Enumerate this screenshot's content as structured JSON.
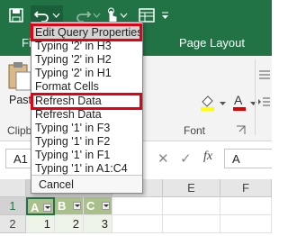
{
  "colors": {
    "excel_green": "#217346",
    "table_header": "#a9c08a",
    "highlight_red": "#e60012"
  },
  "qat": {
    "icons": [
      "save-icon",
      "undo-icon",
      "undo-dropdown-icon",
      "redo-icon",
      "touch-mode-icon",
      "form-icon"
    ]
  },
  "tabs": [
    {
      "label": "Fi"
    },
    {
      "label": "Page Layout"
    }
  ],
  "ribbon": {
    "paste_label": "Past",
    "clipboard_label": "Clipb",
    "font_label": "Font"
  },
  "formula_bar": {
    "name_box": "A1",
    "fx_label": "fx",
    "value": "A"
  },
  "grid": {
    "columns": [
      "D",
      "E",
      "F"
    ],
    "rows": [
      "1",
      "2"
    ],
    "table_headers": [
      "A",
      "B",
      "C"
    ],
    "row2_values": [
      "1",
      "2",
      "3"
    ]
  },
  "undo_menu": {
    "items": [
      "Edit Query Properties",
      "Typing '2' in H3",
      "Typing '2' in H2",
      "Typing '2' in H1",
      "Format Cells",
      "Refresh Data",
      "Refresh Data",
      "Typing '1' in F3",
      "Typing '1' in F2",
      "Typing '1' in F1",
      "Typing '1' in A1:C4"
    ],
    "cancel_label": "Cancel"
  }
}
